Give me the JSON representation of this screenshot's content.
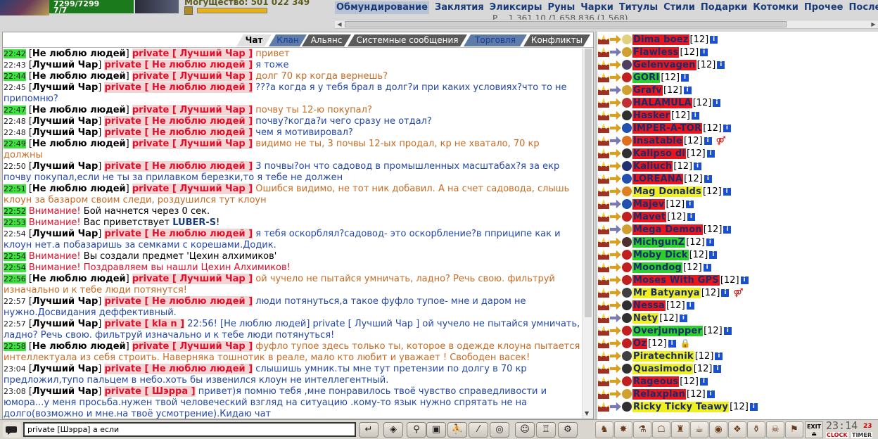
{
  "header": {
    "hp": "7299/7299",
    "mana": "7/7",
    "power_label": "Могущество: 501 022 349",
    "nav": [
      "Обмундирование",
      "Заклятия",
      "Эликсиры",
      "Руны",
      "Чарки",
      "Титулы",
      "Стили",
      "Подарки",
      "Котомки",
      "Прочее",
      "Послед"
    ],
    "subline": "Р...       1 361 10 /1 658             836 (1 568)"
  },
  "tabs": [
    {
      "label": "Чат",
      "bg": "#e0e0e0",
      "color": "#000"
    },
    {
      "label": "Клан",
      "bg": "#5f7ba8",
      "color": "#1a3d9a"
    },
    {
      "label": "Альянс",
      "bg": "#5a5a5a",
      "color": "#fff"
    },
    {
      "label": "Системные сообщения",
      "bg": "#5a5a5a",
      "color": "#fff"
    },
    {
      "label": "Торговля",
      "bg": "#5f7ba8",
      "color": "#1a3d9a"
    },
    {
      "label": "Конфликты",
      "bg": "#5a5a5a",
      "color": "#fff"
    }
  ],
  "chat": [
    {
      "time": "22:42",
      "hl": true,
      "nick": "Не люблю людей",
      "to": "Лучший Чар",
      "text": "привет",
      "tone": "red"
    },
    {
      "time": "22:43",
      "hl": false,
      "nick": "Лучший Чар",
      "to": "Не люблю людей",
      "text": "я тоже",
      "tone": "blue"
    },
    {
      "time": "22:44",
      "hl": true,
      "nick": "Не люблю людей",
      "to": "Лучший Чар",
      "text": "долг 70 кр когда вернешь?",
      "tone": "red"
    },
    {
      "time": "22:45",
      "hl": false,
      "nick": "Лучший Чар",
      "to": "Не люблю людей",
      "text": "???а когда я у тебя брал в долг?и при каких условиях?что то не припомню?",
      "tone": "blue"
    },
    {
      "time": "22:47",
      "hl": true,
      "nick": "Не люблю людей",
      "to": "Лучший Чар",
      "text": "почву ты 12-ю покупал?",
      "tone": "red"
    },
    {
      "time": "22:48",
      "hl": false,
      "nick": "Лучший Чар",
      "to": "Не люблю людей",
      "text": "почву?когда?и чего сразу не отдал?",
      "tone": "blue"
    },
    {
      "time": "22:48",
      "hl": false,
      "nick": "Лучший Чар",
      "to": "Не люблю людей",
      "text": "чем я мотивировал?",
      "tone": "blue"
    },
    {
      "time": "22:49",
      "hl": true,
      "nick": "Не люблю людей",
      "to": "Лучший Чар",
      "text": "видимо не ты, 3 почвы 12-ых продал, кр не хватало, 70 кр должны",
      "tone": "red"
    },
    {
      "time": "22:50",
      "hl": false,
      "nick": "Лучший Чар",
      "to": "Не люблю людей",
      "text": "3 почвы?он что садовод в промышленных масштабах?я за екр почву покупал,если не ты за прилавком березки,то я тебе не должен",
      "tone": "blue"
    },
    {
      "time": "22:51",
      "hl": true,
      "nick": "Не люблю людей",
      "to": "Лучший Чар",
      "text": "Ошибся видимо, не тот ник добавил. А на счет садовода, слышь клоун за базаром своим следи, роздушился тут клоун",
      "tone": "red"
    },
    {
      "time": "22:52",
      "hl": true,
      "sys": "Внимание!",
      "text": "Бой начнется через 0 сек."
    },
    {
      "time": "22:53",
      "hl": true,
      "sys": "Внимание!",
      "text": "Вас приветствует",
      "bold": "LUBER-S",
      "tail": "!"
    },
    {
      "time": "22:54",
      "hl": false,
      "nick": "Лучший Чар",
      "to": "Не люблю людей",
      "text": "я тебя оскорблял?садовод- это оскорбление?в пприципе как и клоун нет.а побазаришь за семками с корешами.Додик.",
      "tone": "blue"
    },
    {
      "time": "22:54",
      "hl": true,
      "sys": "Внимание!",
      "text": "Вы создали предмет 'Цехин алхимиков'"
    },
    {
      "time": "22:54",
      "hl": true,
      "sys": "Внимание!",
      "text": "Поздравляем вы нашли Цехин Алхимиков!",
      "allred": true
    },
    {
      "time": "22:56",
      "hl": true,
      "nick": "Не люблю людей",
      "to": "Лучший Чар",
      "text": "ой чучело не пытайся умничать, ладно? Речь свою. фильтруй изначально и к тебе люди потянутся!",
      "tone": "red"
    },
    {
      "time": "22:57",
      "hl": false,
      "nick": "Лучший Чар",
      "to": "Не люблю людей",
      "text": "люди потянуться,а такое фуфло тупое- мне и даром не нужно.Досвидания деффективный.",
      "tone": "blue"
    },
    {
      "time": "22:57",
      "hl": false,
      "nick": "Лучший Чар",
      "to": "kla n",
      "text": "22:56! [Не люблю людей] private [ Лучший Чар ] ой чучело не пытайся умничать, ладно? Речь свою. фильтруй изначально и к тебе люди потянуться!",
      "tone": "blue"
    },
    {
      "time": "22:58",
      "hl": true,
      "nick": "Не люблю людей",
      "to": "Лучший Чар",
      "text": "фуфло тупое здесь только ты, которое в одежде клоуна пытается интеллектуала из себя строить. Наверняка тошнотик в реале, мало кто любит и уважает ! Свободен васек!",
      "tone": "red"
    },
    {
      "time": "23:04",
      "hl": false,
      "nick": "Лучший Чар",
      "to": "Не люблю людей",
      "text": "слышишь умник.ты мне тут претензии по долгу в 70 кр предложил,тупо пальцем в небо.хоть бы извенился клоун не интеллегентный.",
      "tone": "blue"
    },
    {
      "time": "23:08",
      "hl": false,
      "nick": "Лучший Чар",
      "to": "Шэрра",
      "text": "привет)я помню тебя ,мне понравилось твоё чувство справедливости и юмора...у меня просьба.нужен твой человеческий взгляд на ситуацию .кому-то язык нужно спрятать не на долго(возможно и мне.на твоё усмотрение).Кидаю чат",
      "tone": "blue"
    }
  ],
  "private_label": "private",
  "players": [
    {
      "name": "Dima boez",
      "lvl": "[12]",
      "bg": "red",
      "clan": "#e0d080",
      "extra": ""
    },
    {
      "name": "Flawless",
      "lvl": "[12]",
      "bg": "red",
      "clan": "#d0a030",
      "extra": ""
    },
    {
      "name": "Gelenvagen",
      "lvl": "[12]",
      "bg": "red",
      "clan": "#504060",
      "extra": ""
    },
    {
      "name": "GORI",
      "lvl": "[12]",
      "bg": "green",
      "clan": "#c02020",
      "extra": ""
    },
    {
      "name": "Grafv",
      "lvl": "[12]",
      "bg": "red",
      "clan": "#d0a030",
      "extra": ""
    },
    {
      "name": "HALAMULA",
      "lvl": "[12]",
      "bg": "red",
      "clan": "#c03030",
      "extra": ""
    },
    {
      "name": "Hasker",
      "lvl": "[12]",
      "bg": "red",
      "clan": "#303030",
      "extra": ""
    },
    {
      "name": "IMPER-A-TOR",
      "lvl": "[12]",
      "bg": "red",
      "clan": "#2050b0",
      "extra": ""
    },
    {
      "name": "Insatable",
      "lvl": "[12]",
      "bg": "red",
      "clan": "#e07020",
      "extra": "⚤"
    },
    {
      "name": "Kalipso di",
      "lvl": "[12]",
      "bg": "red",
      "clan": "#303030",
      "extra": ""
    },
    {
      "name": "Kaliuch",
      "lvl": "[12]",
      "bg": "red",
      "clan": "#203070",
      "extra": ""
    },
    {
      "name": "LOREANA",
      "lvl": "[12]",
      "bg": "red",
      "clan": "#2050b0",
      "extra": ""
    },
    {
      "name": "Mag Donalds",
      "lvl": "[12]",
      "bg": "yellow",
      "clan": "#e08020",
      "extra": ""
    },
    {
      "name": "Majev",
      "lvl": "[12]",
      "bg": "red",
      "clan": "#2050b0",
      "extra": ""
    },
    {
      "name": "Mavet",
      "lvl": "[12]",
      "bg": "red",
      "clan": "#c02020",
      "extra": ""
    },
    {
      "name": "Mega Demon",
      "lvl": "[12]",
      "bg": "red",
      "clan": "#d0a030",
      "extra": ""
    },
    {
      "name": "MichgunZ",
      "lvl": "[12]",
      "bg": "green",
      "clan": "#503030",
      "extra": ""
    },
    {
      "name": "Moby Dick",
      "lvl": "[12]",
      "bg": "green",
      "clan": "#c02020",
      "extra": ""
    },
    {
      "name": "Moondog",
      "lvl": "[12]",
      "bg": "green",
      "clan": "#c02020",
      "extra": ""
    },
    {
      "name": "Moses With GPS",
      "lvl": "[12]",
      "bg": "red",
      "clan": "#c02020",
      "extra": ""
    },
    {
      "name": "Mr Batyanya",
      "lvl": "[12]",
      "bg": "yellow",
      "clan": "#404040",
      "extra": "⚤"
    },
    {
      "name": "Nessa",
      "lvl": "[12]",
      "bg": "red",
      "clan": "#303030",
      "extra": ""
    },
    {
      "name": "Nety",
      "lvl": "[12]",
      "bg": "yellow",
      "clan": "#303030",
      "extra": ""
    },
    {
      "name": "Overjumpper",
      "lvl": "[12]",
      "bg": "green",
      "clan": "#c02020",
      "extra": ""
    },
    {
      "name": "Oz",
      "lvl": "[12]",
      "bg": "red",
      "clan": "#c02020",
      "extra": "🔒"
    },
    {
      "name": "Piratechnik",
      "lvl": "[12]",
      "bg": "yellow",
      "clan": "#404040",
      "extra": ""
    },
    {
      "name": "Quasimodo",
      "lvl": "[12]",
      "bg": "yellow",
      "clan": "#303030",
      "extra": ""
    },
    {
      "name": "Rageous",
      "lvl": "[12]",
      "bg": "red",
      "clan": "#c02020",
      "extra": ""
    },
    {
      "name": "Relaxplan",
      "lvl": "[12]",
      "bg": "red",
      "clan": "#d0a030",
      "extra": ""
    },
    {
      "name": "Ricky Ticky Teawy",
      "lvl": "[12]",
      "bg": "yellow",
      "clan": "#303030",
      "extra": ""
    }
  ],
  "bottom": {
    "input_value": "private [Шэрра] а если",
    "time": "23:14",
    "seconds": "23",
    "clock_label": "CLOCK",
    "timer_label": "TIMER",
    "exit_label": "EXIT",
    "tools": [
      {
        "name": "enter-icon",
        "glyph": "↵"
      },
      {
        "name": "eraser-icon",
        "glyph": "◈"
      },
      {
        "name": "filter-icon",
        "glyph": "⚲"
      },
      {
        "name": "save-icon",
        "glyph": "▣"
      },
      {
        "name": "runner-icon",
        "glyph": "⛹"
      },
      {
        "name": "slash-icon",
        "glyph": "⁄"
      },
      {
        "name": "shield-icon",
        "glyph": "◎"
      },
      {
        "name": "smile-icon",
        "glyph": "☺"
      },
      {
        "name": "helmet-icon",
        "glyph": "♖"
      },
      {
        "name": "settings-icon",
        "glyph": "⚙"
      }
    ],
    "right_tools": [
      {
        "name": "scroll-icon",
        "glyph": "♞"
      },
      {
        "name": "star-icon",
        "glyph": "✸"
      },
      {
        "name": "flask-icon",
        "glyph": "⚗"
      },
      {
        "name": "chest-icon",
        "glyph": "☖"
      },
      {
        "name": "bag-icon",
        "glyph": "♜"
      },
      {
        "name": "pot-icon",
        "glyph": "☕"
      },
      {
        "name": "eye-icon",
        "glyph": "◉"
      },
      {
        "name": "gift-icon",
        "glyph": "❖"
      },
      {
        "name": "bottle-icon",
        "glyph": "⚱"
      },
      {
        "name": "skull-icon",
        "glyph": "☠"
      },
      {
        "name": "flag-icon",
        "glyph": "⚑"
      }
    ]
  }
}
